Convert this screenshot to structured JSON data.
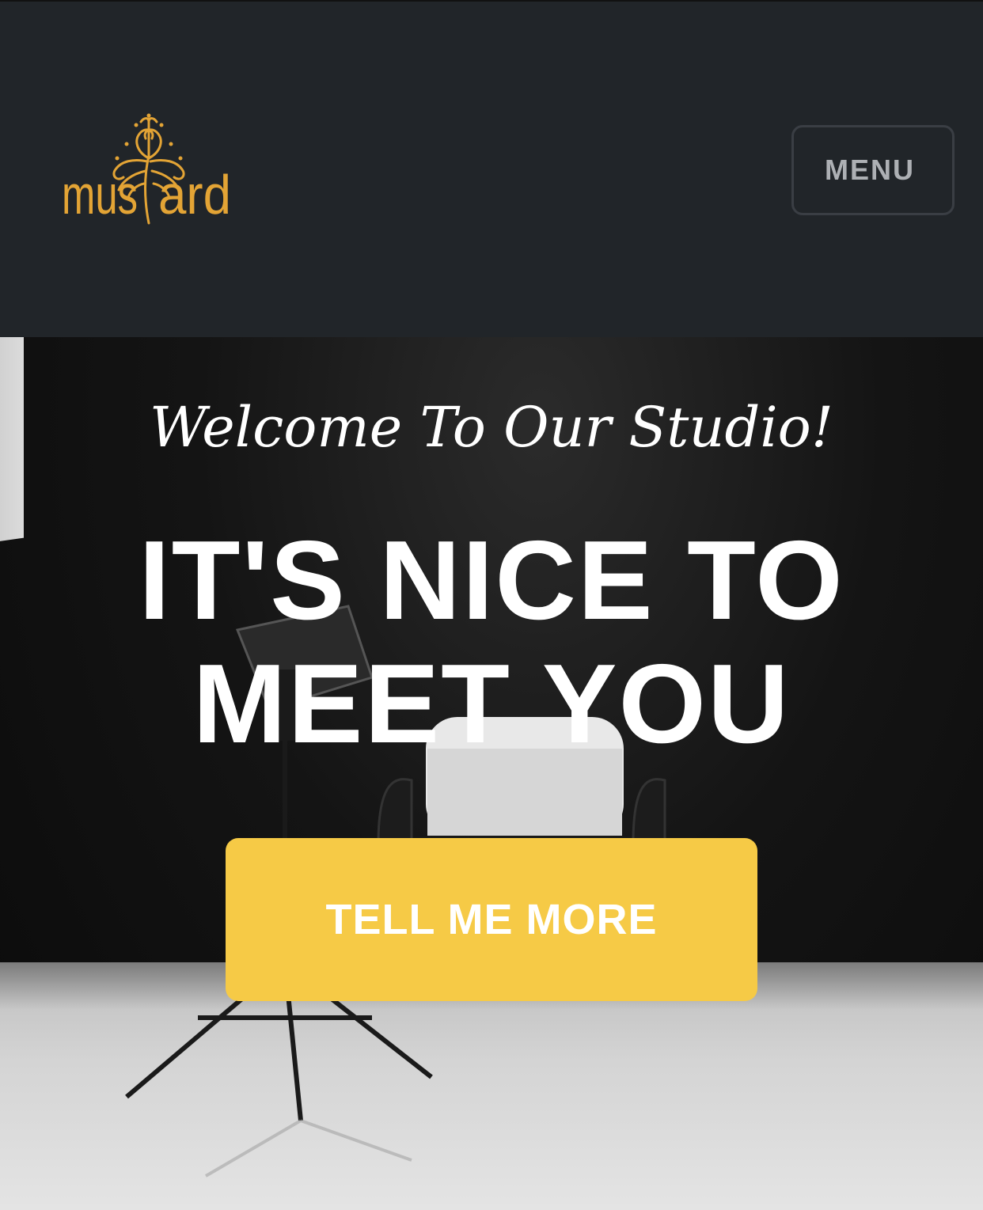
{
  "navbar": {
    "logo_text": "mustard",
    "menu_label": "MENU"
  },
  "hero": {
    "subheading": "Welcome To Our Studio!",
    "heading_line1": "IT'S NICE TO",
    "heading_line2": "MEET YOU",
    "cta_label": "TELL ME MORE"
  },
  "colors": {
    "navbar_bg": "#212529",
    "brand_gold": "#e3a435",
    "cta_bg": "#f6ca46",
    "menu_text": "#adb0b4"
  },
  "icons": {
    "logo": "mustard-tree-logo",
    "scene": "photo-studio-background"
  }
}
